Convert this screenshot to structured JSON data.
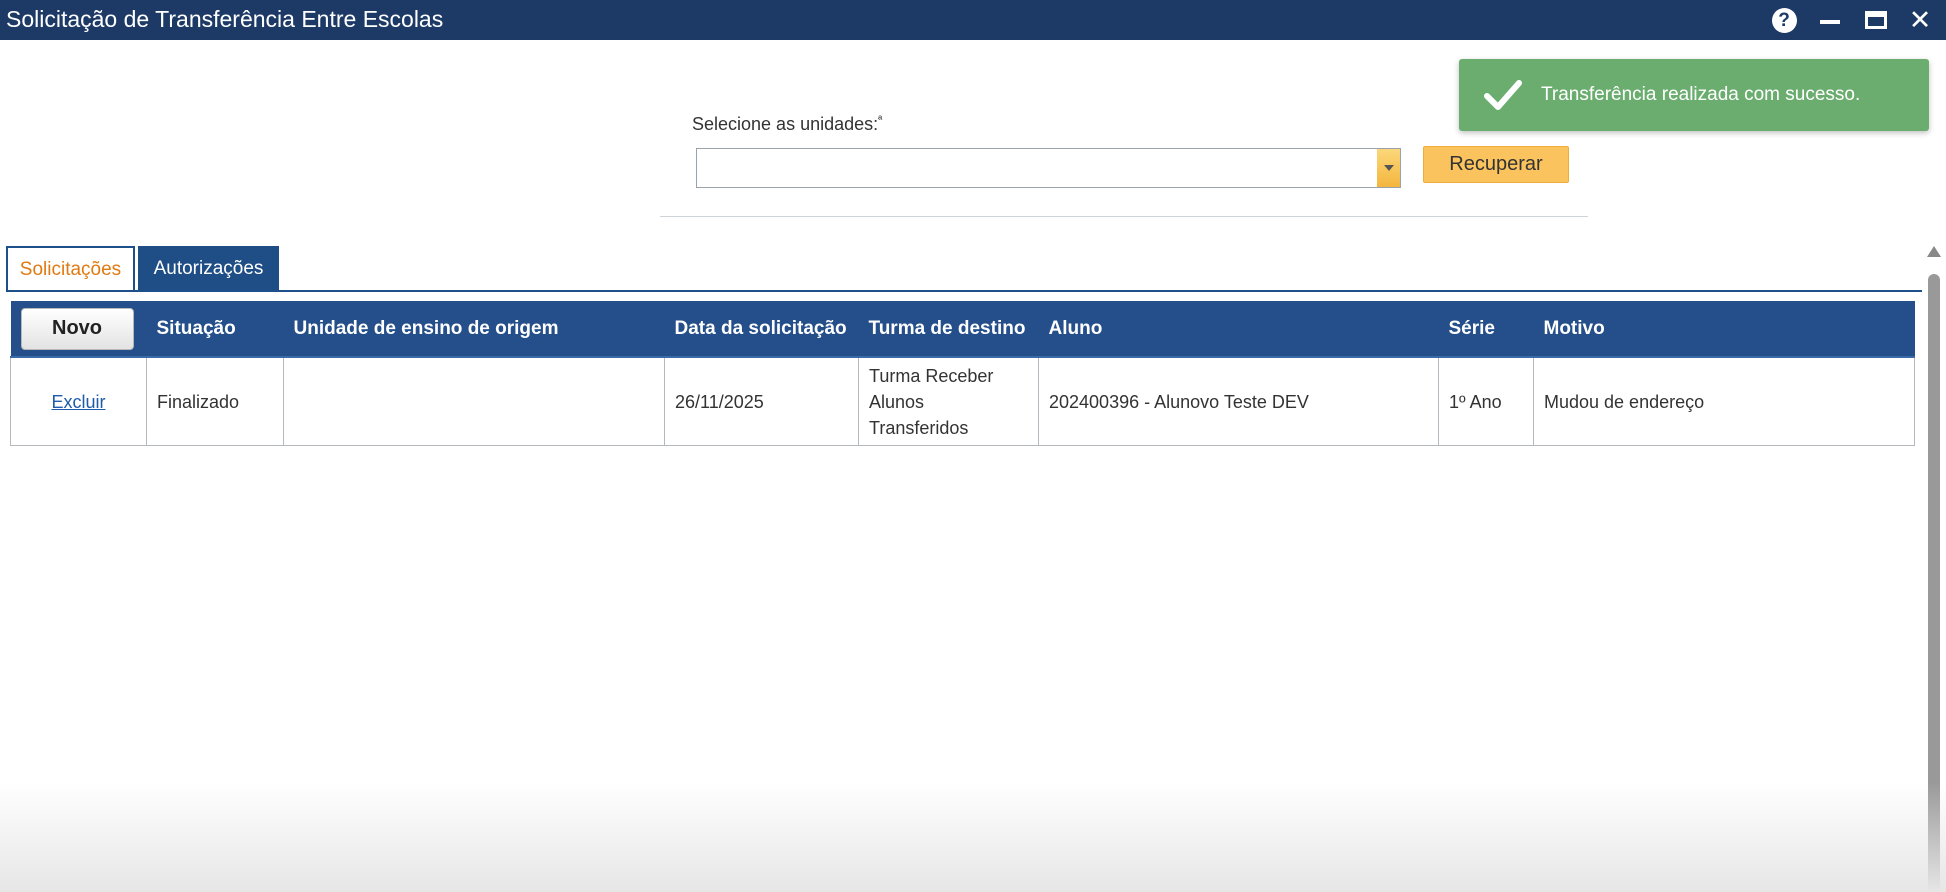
{
  "window": {
    "title": "Solicitação de Transferência Entre Escolas",
    "help_glyph": "?",
    "close_glyph": "✕"
  },
  "toast": {
    "message": "Transferência realizada com sucesso.",
    "icon": "checkmark-icon",
    "color": "#6aad6f"
  },
  "filter": {
    "label": "Selecione as unidades:",
    "required_mark": "ª",
    "selected_value": "",
    "button_label": "Recuperar"
  },
  "tabs": [
    {
      "label": "Solicitações",
      "active": true
    },
    {
      "label": "Autorizações",
      "active": false
    }
  ],
  "grid": {
    "new_button_label": "Novo",
    "columns": [
      "Situação",
      "Unidade de ensino de origem",
      "Data da solicitação",
      "Turma de destino",
      "Aluno",
      "Série",
      "Motivo"
    ],
    "rows": [
      {
        "action": "Excluir",
        "situacao": "Finalizado",
        "unidade_origem": "",
        "data_solicitacao": "26/11/2025",
        "turma_destino": "Turma Receber Alunos Transferidos",
        "aluno": "202400396 - Alunovo Teste DEV",
        "serie": "1º Ano",
        "motivo": "Mudou de endereço"
      }
    ]
  },
  "colors": {
    "titlebar": "#1d3a66",
    "header": "#244f8a",
    "accent_orange": "#e07a10",
    "button_yellow": "#fbc35d"
  }
}
